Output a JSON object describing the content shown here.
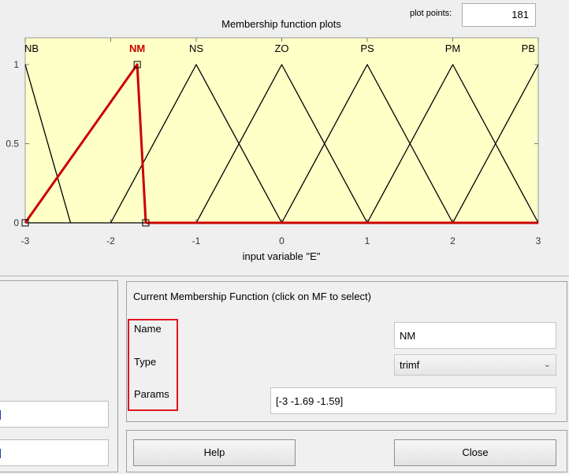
{
  "plot": {
    "title": "Membership function plots",
    "plot_points_label": "plot points:",
    "plot_points_value": "181",
    "xlabel": "input variable \"E\"",
    "background": "#ffffc8",
    "selected_color": "#cc0000"
  },
  "chart_data": {
    "type": "line",
    "title": "Membership function plots",
    "xlabel": "input variable \"E\"",
    "ylabel": "",
    "xlim": [
      -3,
      3
    ],
    "ylim": [
      0,
      1
    ],
    "x_ticks": [
      "-3",
      "-2",
      "-1",
      "0",
      "1",
      "2",
      "3"
    ],
    "y_ticks": [
      "0",
      "0.5",
      "1"
    ],
    "grid": false,
    "series": [
      {
        "name": "NB",
        "label_x": -3,
        "x": [
          -3,
          -2.47
        ],
        "y": [
          1,
          0
        ]
      },
      {
        "name": "NM",
        "label_x": -1.69,
        "selected": true,
        "x": [
          -3,
          -1.69,
          -1.59
        ],
        "y": [
          0,
          1,
          0
        ]
      },
      {
        "name": "NS",
        "label_x": -1,
        "x": [
          -2,
          -1,
          0
        ],
        "y": [
          0,
          1,
          0
        ]
      },
      {
        "name": "ZO",
        "label_x": 0,
        "x": [
          -1,
          0,
          1
        ],
        "y": [
          0,
          1,
          0
        ]
      },
      {
        "name": "PS",
        "label_x": 1,
        "x": [
          0,
          1,
          2
        ],
        "y": [
          0,
          1,
          0
        ]
      },
      {
        "name": "PM",
        "label_x": 2,
        "x": [
          1,
          2,
          3
        ],
        "y": [
          0,
          1,
          0
        ]
      },
      {
        "name": "PB",
        "label_x": 3,
        "x": [
          2,
          3
        ],
        "y": [
          0,
          1
        ]
      }
    ]
  },
  "current_mf": {
    "title": "Current Membership Function (click on MF to select)",
    "name_label": "Name",
    "type_label": "Type",
    "params_label": "Params",
    "name_value": "NM",
    "type_value": "trimf",
    "params_value": "[-3 -1.69 -1.59]"
  },
  "buttons": {
    "help": "Help",
    "close": "Close"
  },
  "highlight_color": "#e2141d",
  "chevron_icon": "chevron-down-icon"
}
